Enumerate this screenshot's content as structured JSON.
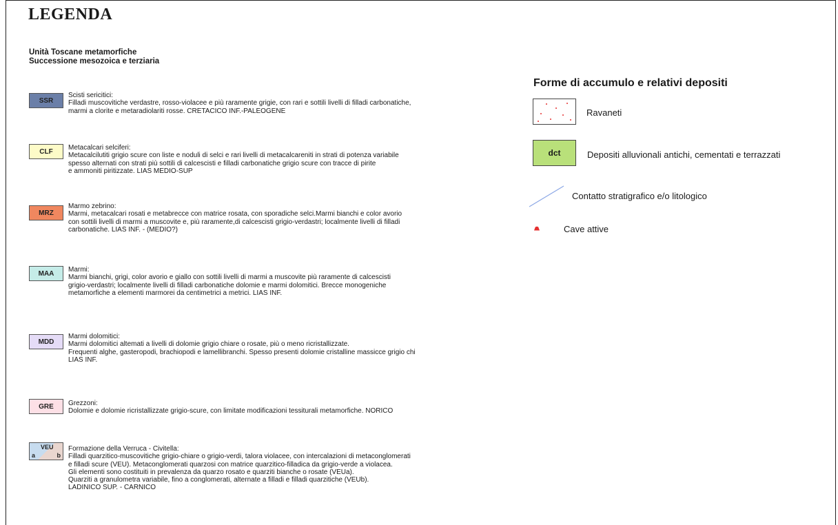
{
  "title": "LEGENDA",
  "subheading": {
    "line1": "Unità Toscane metamorfiche",
    "line2": "Successione mesozoica e terziaria"
  },
  "units": [
    {
      "code": "SSR",
      "color": "#6b7fa8",
      "name": "Scisti sericitici:",
      "desc": "Filladi muscovitiche verdastre, rosso-violacee e più raramente grigie, con rari e sottili livelli di filladi carbonatiche,\nmarmi a clorite e metaradiolariti rosse. CRETACICO INF.-PALEOGENE"
    },
    {
      "code": "CLF",
      "color": "#fdfbc8",
      "name": "Metacalcari selciferi:",
      "desc": "Metacalcilutiti grigio scure con liste e noduli di selci e rari livelli di metacalcareniti in strati di potenza variabile\nspesso alternati con strati più sottili di calcescisti e filladi carbonatiche grigio scure con tracce di pirite\ne ammoniti piritizzate. LIAS MEDIO-SUP"
    },
    {
      "code": "MRZ",
      "color": "#f0875f",
      "name": "Marmo zebrino:",
      "desc": "Marmi, metacalcari rosati e metabrecce con matrice rosata, con sporadiche selci.Marmi bianchi e color avorio\ncon sottili livelli di marmi a muscovite e, più raramente,di calcescisti grigio-verdastri; localmente livelli di filladi\ncarbonatiche. LIAS INF. - (MEDIO?)"
    },
    {
      "code": "MAA",
      "color": "#c5ece8",
      "name": "Marmi:",
      "desc": "Marmi bianchi, grigi, color avorio e giallo con sottili livelli di marmi a muscovite più raramente di calcescisti\ngrigio-verdastri; localmente livelli di filladi carbonatiche dolomie e marmi dolomitici. Brecce monogeniche\nmetamorfiche a elementi marmorei da centimetrici a metrici. LIAS INF."
    },
    {
      "code": "MDD",
      "color": "#e5dcf7",
      "name": "Marmi dolomitici:",
      "desc": "Marmi dolomitici altemati a livelli di dolomie grigio chiare o rosate, più o meno ricristallizzate.\nFrequenti alghe, gasteropodi, brachiopodi e lamellibranchi. Spesso presenti dolomie cristalline massicce grigio chi\nLIAS INF."
    },
    {
      "code": "GRE",
      "color": "#fde0e6",
      "name": "Grezzoni:",
      "desc": "Dolomie e dolomie ricristallizzate grigio-scure, con limitate modificazioni tessiturali metamorfiche. NORICO"
    }
  ],
  "veu": {
    "code": "VEU",
    "sub_a": "a",
    "sub_b": "b",
    "name": "Formazione della Verruca - Civitella:",
    "desc": "Filladi quarzitico-muscovitiche grigio-chiare o grigio-verdi, talora violacee, con intercalazioni di metaconglomerati\ne filladi scure (VEU). Metaconglomerati quarzosi con matrice quarzitico-filladica da grigio-verde a violacea.\nGli elementi sono costituiti in prevalenza da quarzo rosato e quarziti bianche o rosate (VEUa).\nQuarziti a granulometra variabile, fino a conglomerati, alternate a filladi e filladi quarzitiche (VEUb).\nLADINICO SUP. - CARNICO"
  },
  "right": {
    "heading": "Forme di accumulo e relativi depositi",
    "ravaneti": "Ravaneti",
    "dct_code": "dct",
    "dct_label": "Depositi alluvionali antichi, cementati e terrazzati",
    "contact_label": "Contatto stratigrafico e/o litologico",
    "cave_label": "Cave attive"
  },
  "colors": {
    "ravaneti_dots": "#e53030",
    "dct_fill": "#b9e07a",
    "contact_line": "#8aa6e6",
    "cave_symbol": "#e53030"
  }
}
